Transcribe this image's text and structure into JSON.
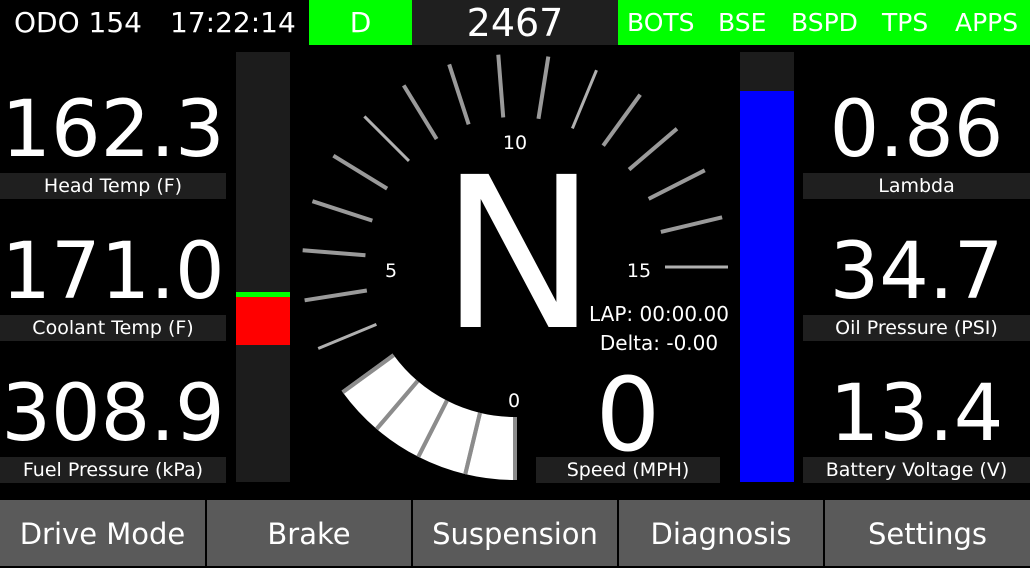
{
  "topbar": {
    "odometer": "ODO 154",
    "clock": "17:22:14",
    "drive_gear": "D",
    "rpm": "2467",
    "flags": [
      "BOTS",
      "BSE",
      "BSPD",
      "TPS",
      "APPS"
    ]
  },
  "left_metrics": [
    {
      "value": "162.3",
      "label": "Head Temp (F)"
    },
    {
      "value": "171.0",
      "label": "Coolant Temp (F)"
    },
    {
      "value": "308.9",
      "label": "Fuel Pressure (kPa)"
    }
  ],
  "right_metrics": [
    {
      "value": "0.86",
      "label": "Lambda"
    },
    {
      "value": "34.7",
      "label": "Oil Pressure (PSI)"
    },
    {
      "value": "13.4",
      "label": "Battery Voltage (V)"
    }
  ],
  "gauge": {
    "tick_labels": [
      "0",
      "5",
      "10",
      "15"
    ],
    "max": 20,
    "value": 4
  },
  "temp_bar": {
    "level": 0.43,
    "marker": 0.5
  },
  "level_bar": {
    "level": 0.91
  },
  "gear_indicator": "N",
  "lap": "LAP: 00:00.00",
  "delta": "Delta: -0.00",
  "speed": {
    "value": "0",
    "label": "Speed (MPH)"
  },
  "nav": [
    "Drive Mode",
    "Brake",
    "Suspension",
    "Diagnosis",
    "Settings"
  ],
  "colors": {
    "ok_green": "#00ff00",
    "alert_red": "#ff0000",
    "level_blue": "#0000ff",
    "button_gray": "#5a5a5a"
  }
}
